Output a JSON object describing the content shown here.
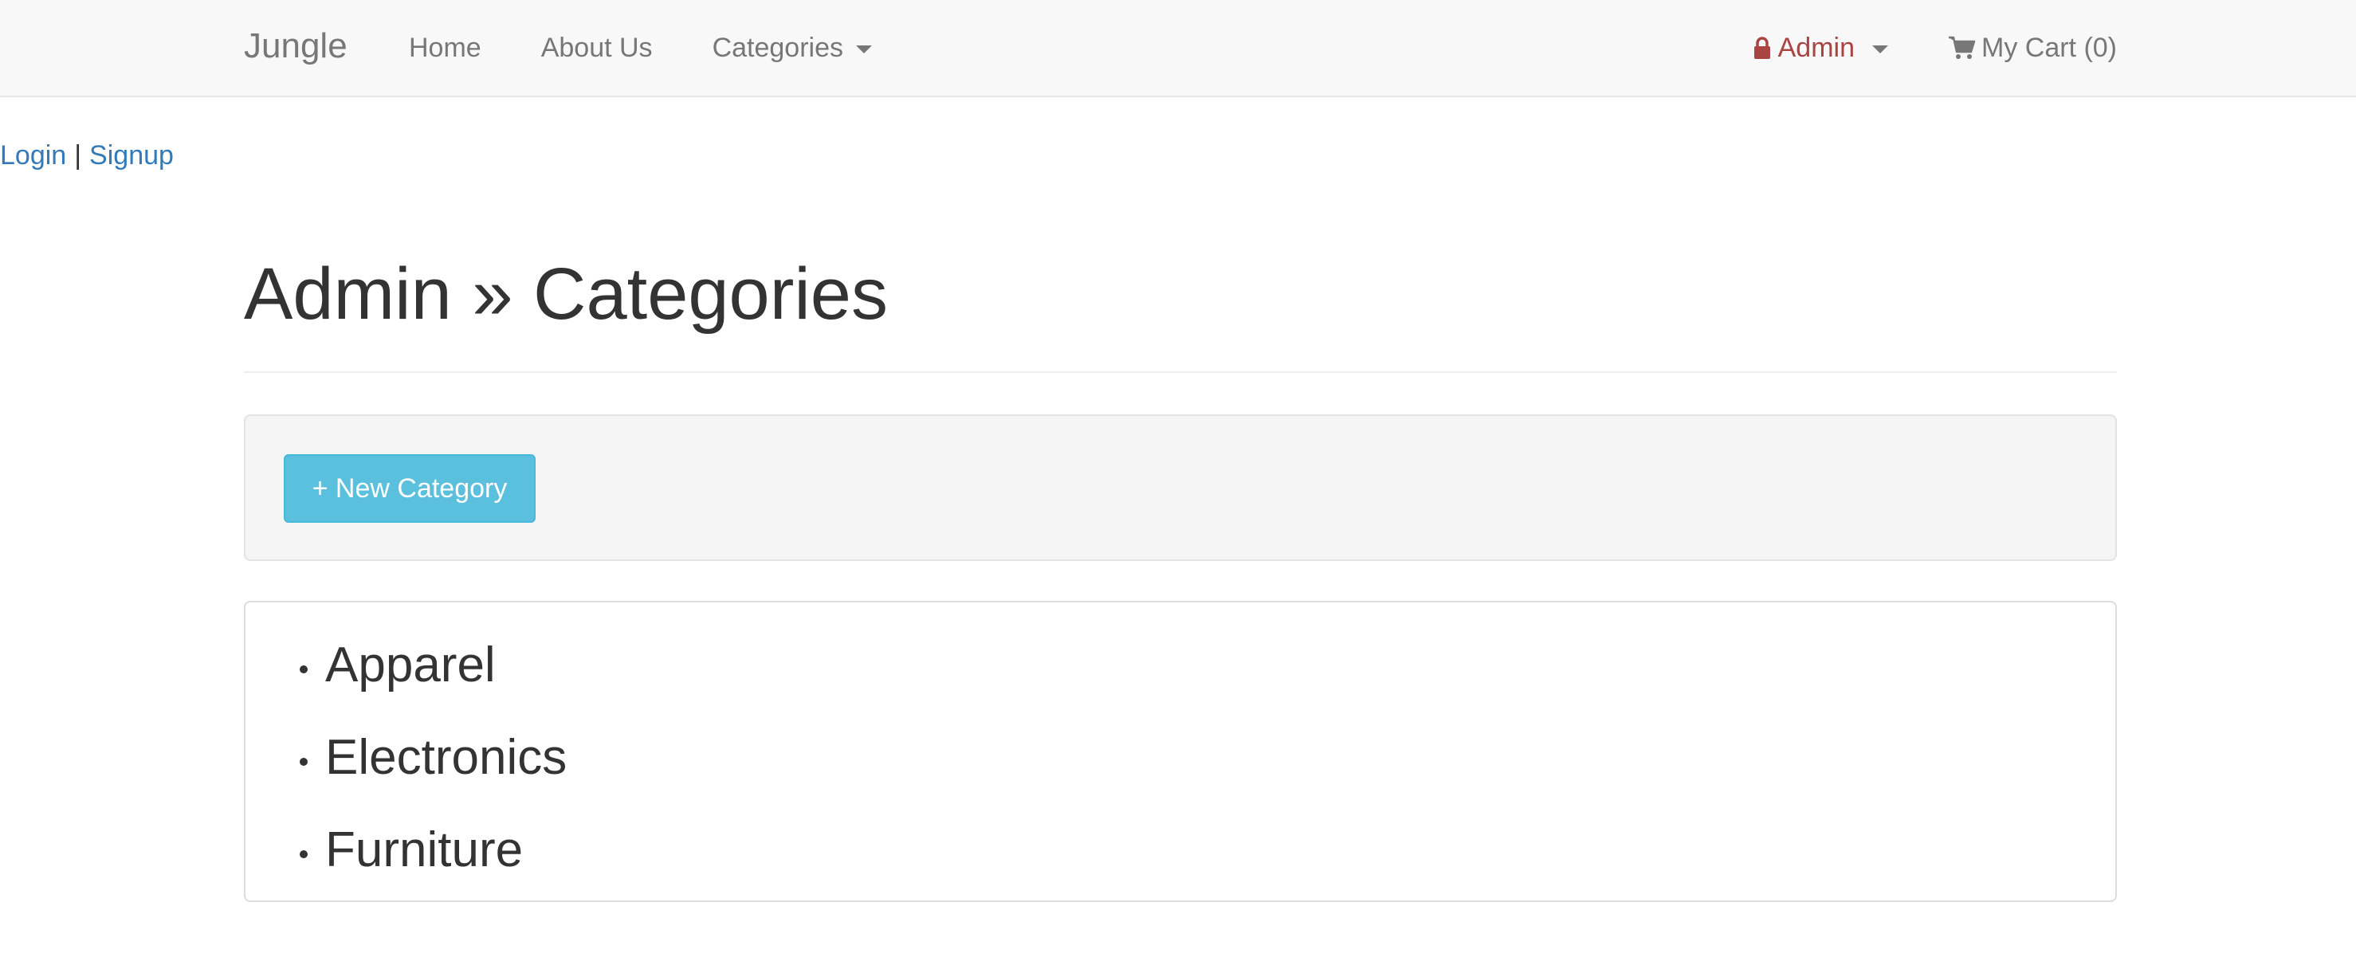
{
  "navbar": {
    "brand": "Jungle",
    "links": [
      {
        "label": "Home"
      },
      {
        "label": "About Us"
      },
      {
        "label": "Categories"
      }
    ],
    "admin_label": "Admin",
    "cart_label": "My Cart (0)"
  },
  "auth": {
    "login": "Login",
    "separator": "|",
    "signup": "Signup"
  },
  "main": {
    "title": "Admin » Categories",
    "new_button": "+ New Category",
    "categories": [
      {
        "name": "Apparel"
      },
      {
        "name": "Electronics"
      },
      {
        "name": "Furniture"
      }
    ]
  },
  "colors": {
    "admin": "#a94442",
    "link": "#337ab7",
    "info_button": "#5bc0de"
  },
  "icons": {
    "admin": "lock-icon",
    "cart": "shopping-cart-icon"
  }
}
